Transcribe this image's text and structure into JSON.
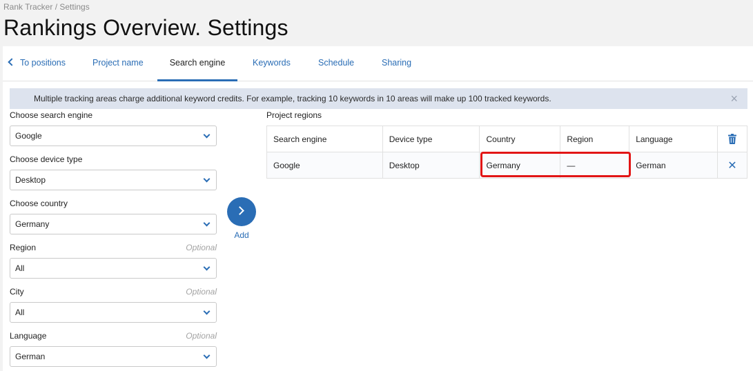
{
  "breadcrumb": "Rank Tracker / Settings",
  "page_title": "Rankings Overview. Settings",
  "tabs": {
    "back": "To positions",
    "items": [
      "Project name",
      "Search engine",
      "Keywords",
      "Schedule",
      "Sharing"
    ],
    "active": "Search engine"
  },
  "info_bar": {
    "message": "Multiple tracking areas charge additional keyword credits. For example, tracking 10 keywords in 10 areas will make up 100 tracked keywords.",
    "close_icon": "×"
  },
  "form": {
    "search_engine": {
      "label": "Choose search engine",
      "value": "Google"
    },
    "device_type": {
      "label": "Choose device type",
      "value": "Desktop"
    },
    "country": {
      "label": "Choose country",
      "value": "Germany"
    },
    "region": {
      "label": "Region",
      "optional": "Optional",
      "value": "All"
    },
    "city": {
      "label": "City",
      "optional": "Optional",
      "value": "All"
    },
    "language": {
      "label": "Language",
      "optional": "Optional",
      "value": "German"
    }
  },
  "add_button": {
    "label": "Add"
  },
  "project_regions": {
    "title": "Project regions",
    "columns": [
      "Search engine",
      "Device type",
      "Country",
      "Region",
      "Language"
    ],
    "rows": [
      {
        "search_engine": "Google",
        "device_type": "Desktop",
        "country": "Germany",
        "region": "—",
        "language": "German"
      }
    ]
  },
  "colors": {
    "accent": "#2a6db5",
    "highlight": "#e21515",
    "info_bg": "#dde3ee"
  }
}
